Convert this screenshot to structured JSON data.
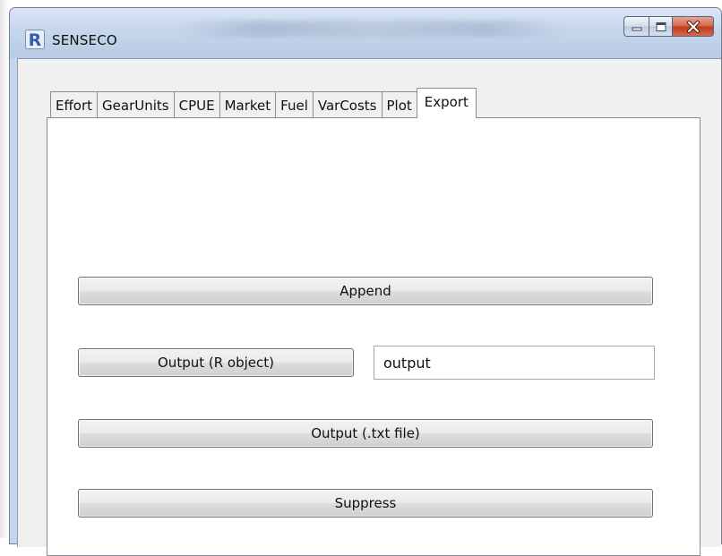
{
  "window": {
    "title": "SENSECO",
    "app_icon": "r-logo-icon",
    "controls": {
      "minimize_icon": "minimize-icon",
      "maximize_icon": "maximize-icon",
      "close_icon": "close-icon"
    },
    "colors": {
      "frame": "#c6d6ea",
      "close_button": "#c23b1e",
      "app_icon": "#2f5fa8"
    }
  },
  "tabs": [
    {
      "label": "Effort",
      "active": false
    },
    {
      "label": "GearUnits",
      "active": false
    },
    {
      "label": "CPUE",
      "active": false
    },
    {
      "label": "Market",
      "active": false
    },
    {
      "label": "Fuel",
      "active": false
    },
    {
      "label": "VarCosts",
      "active": false
    },
    {
      "label": "Plot",
      "active": false
    },
    {
      "label": "Export",
      "active": true
    }
  ],
  "export_panel": {
    "append_label": "Append",
    "output_r_label": "Output (R object)",
    "output_name_value": "output",
    "output_txt_label": "Output (.txt file)",
    "suppress_label": "Suppress"
  }
}
